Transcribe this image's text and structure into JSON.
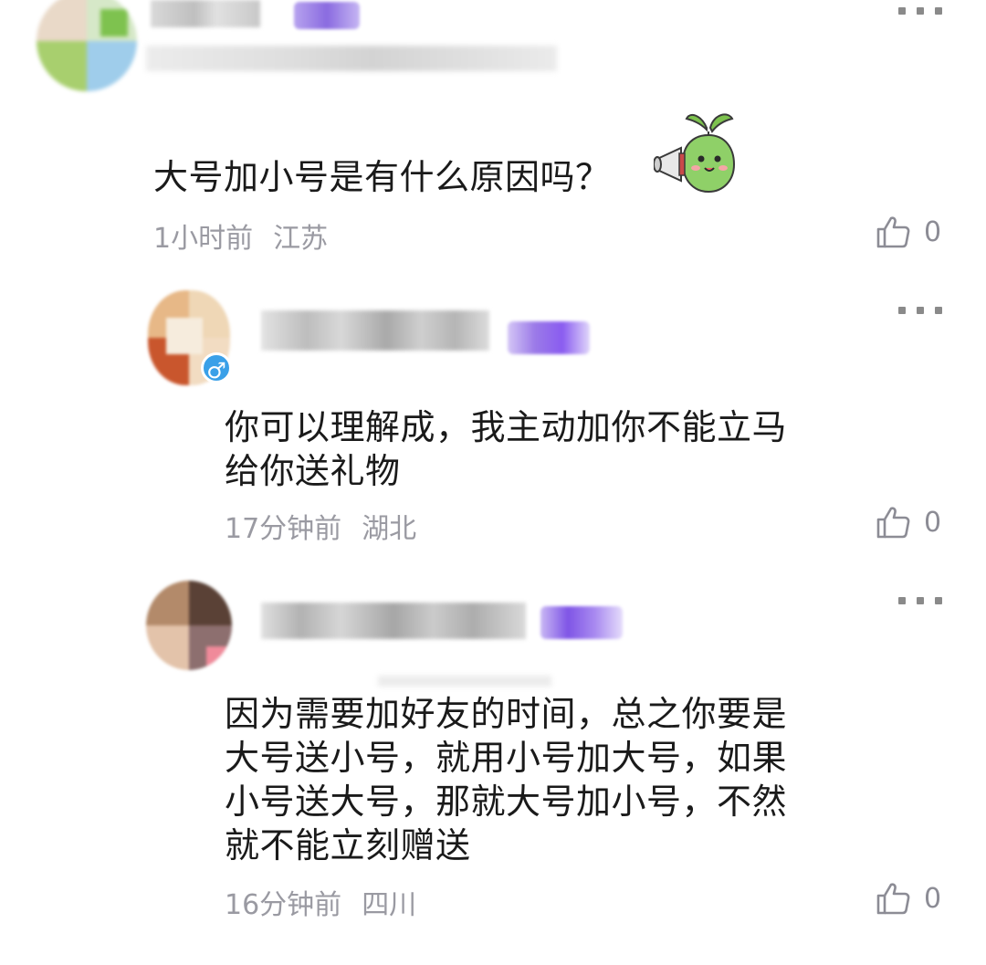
{
  "comments": [
    {
      "text": "大号加小号是有什么原因吗？",
      "time": "1小时前",
      "location": "江苏",
      "likes": "0",
      "has_sticker": true,
      "sticker": "sprout-megaphone-sticker"
    },
    {
      "text": "你可以理解成，我主动加你不能立马\n给你送礼物",
      "time": "17分钟前",
      "location": "湖北",
      "likes": "0",
      "gender_badge": "♂"
    },
    {
      "text": "因为需要加好友的时间，总之你要是\n大号送小号，就用小号加大号，如果\n小号送大号，那就大号加小号，不然\n就不能立刻赠送",
      "time": "16分钟前",
      "location": "四川",
      "likes": "0"
    }
  ],
  "icons": {
    "more": "more-dots-icon",
    "like": "thumbs-up-icon"
  },
  "colors": {
    "meta_text": "#9a9aa2",
    "body_text": "#1a1a1a",
    "badge_purple": "#8a5cf0",
    "gender_blue": "#3aa0e8"
  }
}
